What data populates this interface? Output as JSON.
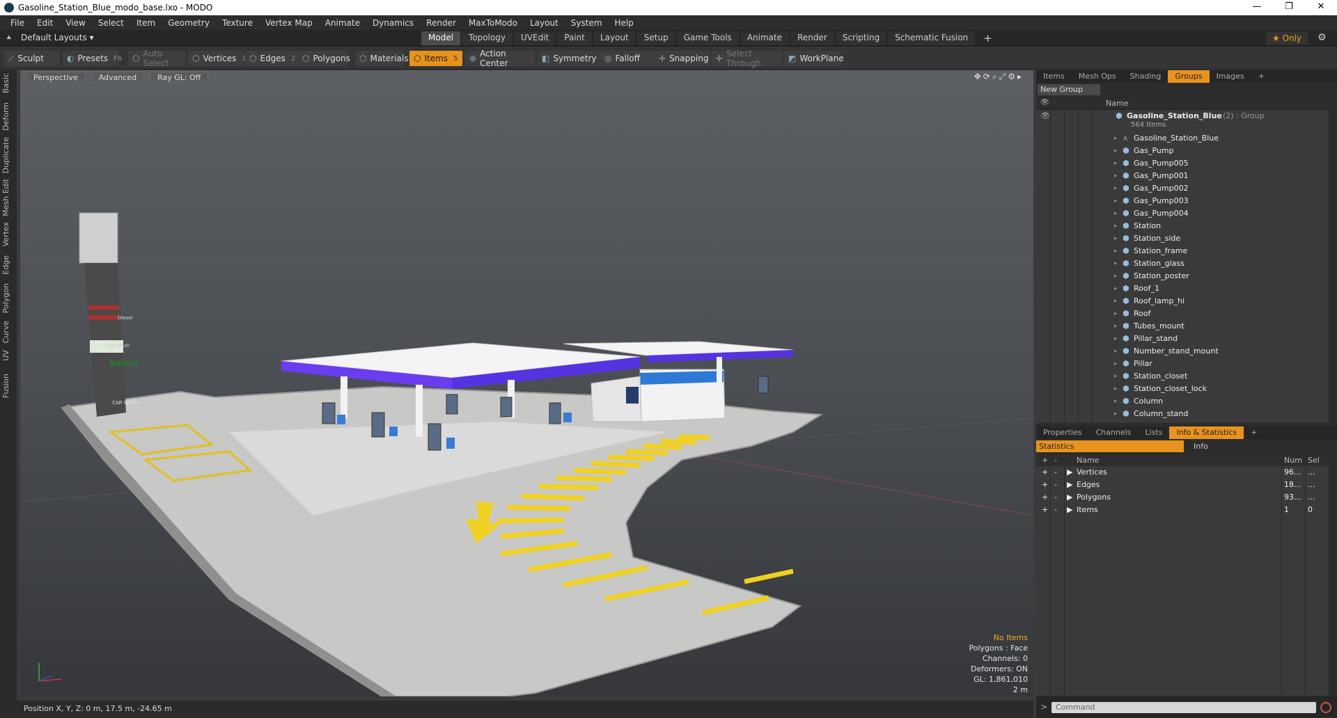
{
  "window": {
    "title": "Gasoline_Station_Blue_modo_base.lxo - MODO",
    "min": "—",
    "max": "❐",
    "close": "✕"
  },
  "menu": [
    "File",
    "Edit",
    "View",
    "Select",
    "Item",
    "Geometry",
    "Texture",
    "Vertex Map",
    "Animate",
    "Dynamics",
    "Render",
    "MaxToModo",
    "Layout",
    "System",
    "Help"
  ],
  "layout": {
    "selector": "Default Layouts ▾",
    "only": "★ Only"
  },
  "tabs": [
    {
      "label": "Model",
      "active": true
    },
    {
      "label": "Topology"
    },
    {
      "label": "UVEdit"
    },
    {
      "label": "Paint"
    },
    {
      "label": "Layout"
    },
    {
      "label": "Setup"
    },
    {
      "label": "Game Tools"
    },
    {
      "label": "Animate"
    },
    {
      "label": "Render"
    },
    {
      "label": "Scripting"
    },
    {
      "label": "Schematic Fusion"
    }
  ],
  "toolbar": {
    "sculpt": "Sculpt",
    "presets": "Presets",
    "presets_key": "F6",
    "auto_select": "Auto Select",
    "vertices": "Vertices",
    "vertices_key": "1",
    "edges": "Edges",
    "edges_key": "2",
    "polygons": "Polygons",
    "materials": "Materials",
    "items": "Items",
    "items_key": "5",
    "action_center": "Action Center",
    "symmetry": "Symmetry",
    "falloff": "Falloff",
    "snapping": "Snapping",
    "select_through": "Select Through",
    "workplane": "WorkPlane"
  },
  "left_strip": [
    "Basic",
    "Deform",
    "Duplicate",
    "Mesh Edit",
    "Vertex",
    "Edge",
    "Polygon",
    "Curve",
    "UV",
    "Fusion"
  ],
  "viewport": {
    "view": "Perspective",
    "shading": "Advanced",
    "raygl": "Ray GL: Off",
    "info": {
      "no_items": "No Items",
      "polygons": "Polygons : Face",
      "channels": "Channels: 0",
      "deformers": "Deformers: ON",
      "gl": "GL: 1,861,010",
      "scale": "2 m"
    },
    "sign": {
      "diesel": "Diesel",
      "car_wash": "Car Wash",
      "select": "Select",
      "car_wash2": "CAR WASH"
    }
  },
  "status": "Position X, Y, Z:  0 m, 17.5 m, -24.65 m",
  "scene_tabs": [
    {
      "label": "Items"
    },
    {
      "label": "Mesh Ops"
    },
    {
      "label": "Shading"
    },
    {
      "label": "Groups",
      "active": true
    },
    {
      "label": "Images"
    },
    {
      "label": "+"
    }
  ],
  "new_group": "New Group",
  "tree_header": "Name",
  "group": {
    "name": "Gasoline_Station_Blue",
    "count": "(2) : Group",
    "items": "564 Items"
  },
  "tree_items": [
    "Gasoline_Station_Blue",
    "Gas_Pump",
    "Gas_Pump005",
    "Gas_Pump001",
    "Gas_Pump002",
    "Gas_Pump003",
    "Gas_Pump004",
    "Station",
    "Station_side",
    "Station_frame",
    "Station_glass",
    "Station_poster",
    "Roof_1",
    "Roof_lamp_hi",
    "Roof",
    "Tubes_mount",
    "Pillar_stand",
    "Number_stand_mount",
    "Pillar",
    "Station_closet",
    "Station_closet_lock",
    "Column",
    "Column_stand"
  ],
  "stat_tabs": [
    {
      "label": "Properties"
    },
    {
      "label": "Channels"
    },
    {
      "label": "Lists"
    },
    {
      "label": "Info & Statistics",
      "active": true
    },
    {
      "label": "+"
    }
  ],
  "stat_sub": {
    "statistics": "Statistics",
    "info": "Info"
  },
  "stat_header": {
    "name": "Name",
    "num": "Num",
    "sel": "Sel"
  },
  "stat_rows": [
    {
      "name": "Vertices",
      "num": "96...",
      "sel": "..."
    },
    {
      "name": "Edges",
      "num": "18...",
      "sel": "..."
    },
    {
      "name": "Polygons",
      "num": "93...",
      "sel": "..."
    },
    {
      "name": "Items",
      "num": "1",
      "sel": "0"
    }
  ],
  "command": {
    "placeholder": "Command",
    "prompt": ">"
  }
}
